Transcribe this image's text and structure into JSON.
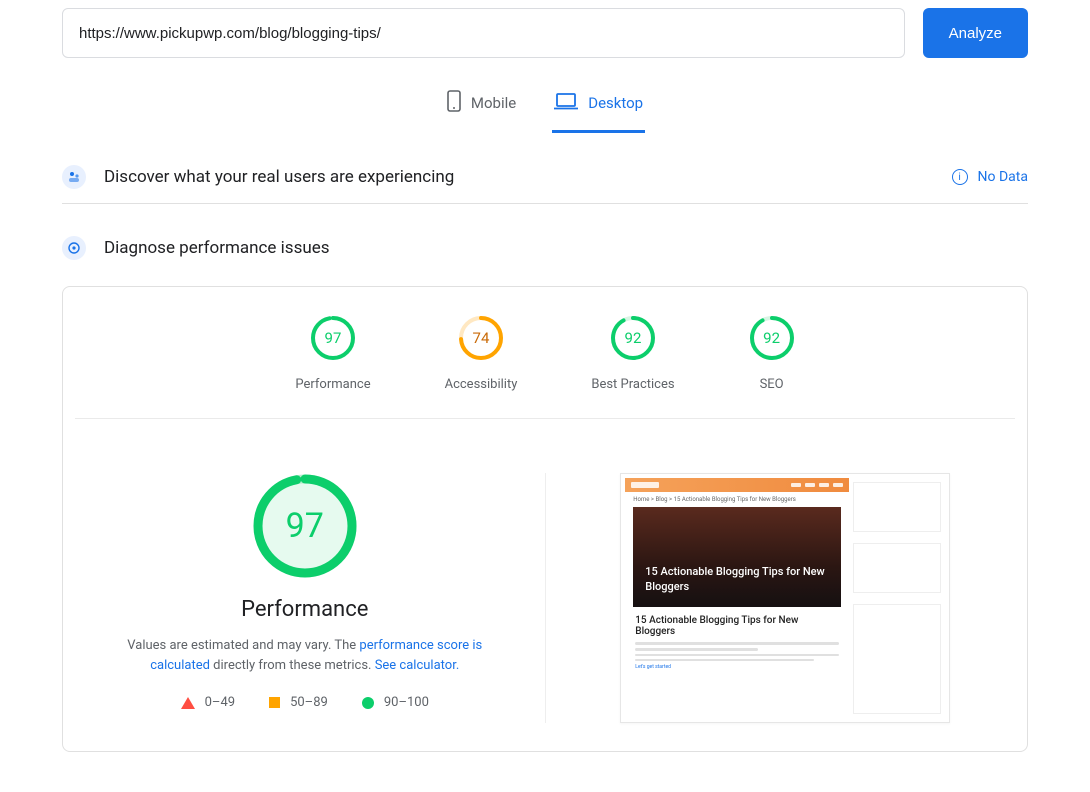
{
  "url_input": {
    "value": "https://www.pickupwp.com/blog/blogging-tips/"
  },
  "analyze_button": "Analyze",
  "tabs": {
    "mobile": "Mobile",
    "desktop": "Desktop",
    "active": "desktop"
  },
  "sections": {
    "discover": "Discover what your real users are experiencing",
    "diagnose": "Diagnose performance issues",
    "no_data": "No Data"
  },
  "gauges": [
    {
      "value": 97,
      "label": "Performance",
      "color": "green"
    },
    {
      "value": 74,
      "label": "Accessibility",
      "color": "orange"
    },
    {
      "value": 92,
      "label": "Best Practices",
      "color": "green"
    },
    {
      "value": 92,
      "label": "SEO",
      "color": "green"
    }
  ],
  "performance": {
    "score": 97,
    "title": "Performance",
    "desc_prefix": "Values are estimated and may vary. The ",
    "link1": "performance score is calculated",
    "desc_mid": " directly from these metrics. ",
    "link2": "See calculator."
  },
  "legend": {
    "red": "0–49",
    "orange": "50–89",
    "green": "90–100"
  },
  "screenshot": {
    "breadcrumb": "Home > Blog > 15 Actionable Blogging Tips for New Bloggers",
    "hero_title": "15 Actionable Blogging Tips for New Bloggers",
    "article_title": "15 Actionable Blogging Tips for New Bloggers",
    "link_text": "Let's get started"
  },
  "colors": {
    "primary": "#1a73e8",
    "green": "#0cce6b",
    "orange": "#ffa400",
    "red": "#ff4e42"
  }
}
